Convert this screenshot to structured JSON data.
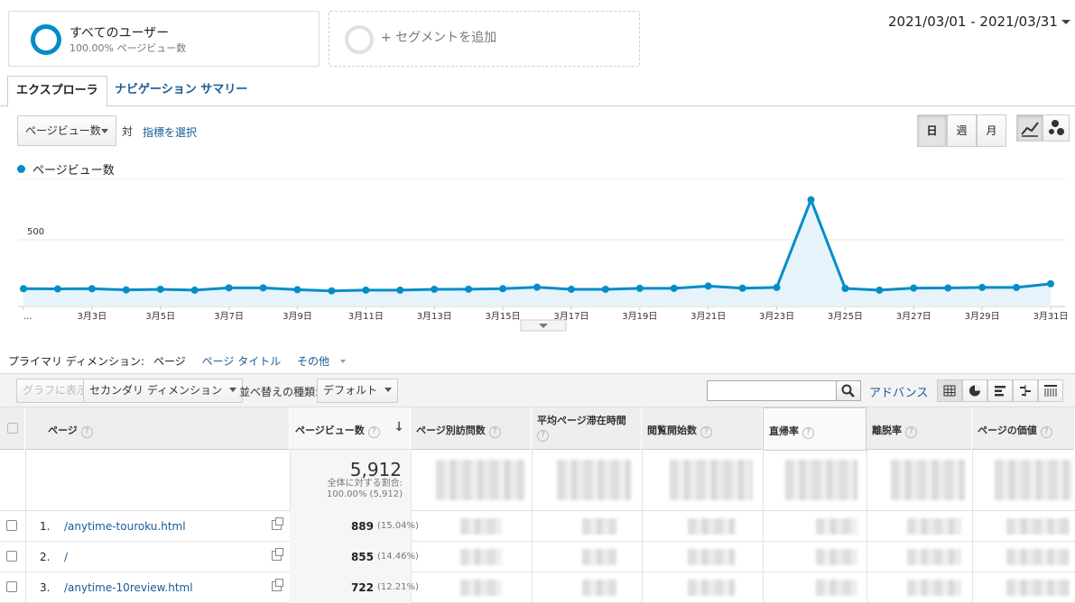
{
  "segments": {
    "all_users": {
      "title": "すべてのユーザー",
      "subtitle": "100.00% ページビュー数"
    },
    "add_segment": "+ セグメントを追加"
  },
  "date_range": "2021/03/01 - 2021/03/31",
  "tabs": [
    {
      "label": "エクスプローラ",
      "active": true
    },
    {
      "label": "ナビゲーション サマリー",
      "active": false
    }
  ],
  "chart_controls": {
    "metric": "ページビュー数",
    "vs": "対",
    "choose_metric": "指標を選択",
    "period_buttons": [
      "日",
      "週",
      "月"
    ],
    "active_period": "日"
  },
  "chart_data": {
    "type": "area",
    "series": [
      {
        "name": "ページビュー数",
        "color": "#058dc7",
        "values": [
          145,
          143,
          145,
          135,
          140,
          133,
          152,
          152,
          137,
          127,
          133,
          133,
          140,
          141,
          145,
          157,
          140,
          140,
          148,
          148,
          166,
          149,
          155,
          870,
          147,
          133,
          150,
          151,
          155,
          155,
          185
        ]
      }
    ],
    "x": [
      "3月1日",
      "3月2日",
      "3月3日",
      "3月4日",
      "3月5日",
      "3月6日",
      "3月7日",
      "3月8日",
      "3月9日",
      "3月10日",
      "3月11日",
      "3月12日",
      "3月13日",
      "3月14日",
      "3月15日",
      "3月16日",
      "3月17日",
      "3月18日",
      "3月19日",
      "3月20日",
      "3月21日",
      "3月22日",
      "3月23日",
      "3月24日",
      "3月25日",
      "3月26日",
      "3月27日",
      "3月28日",
      "3月29日",
      "3月30日",
      "3月31日"
    ],
    "x_tick_labels": [
      "...",
      "3月3日",
      "3月5日",
      "3月7日",
      "3月9日",
      "3月11日",
      "3月13日",
      "3月15日",
      "3月17日",
      "3月19日",
      "3月21日",
      "3月23日",
      "3月25日",
      "3月27日",
      "3月29日",
      "3月31日"
    ],
    "y_tick_labels": [
      "1,000",
      "500"
    ],
    "ylim": [
      0,
      1000
    ],
    "grid": true,
    "legend": "top-left"
  },
  "dimensions": {
    "label": "プライマリ ディメンション:",
    "current": "ページ",
    "alt": "ページ タイトル",
    "more": "その他"
  },
  "toolbar": {
    "plot_rows": "グラフに表示",
    "secondary_dimension": "セカンダリ ディメンション",
    "sort_type_label": "並べ替えの種類:",
    "sort_value": "デフォルト",
    "advanced": "アドバンス"
  },
  "table": {
    "headers": [
      "ページ",
      "ページビュー数",
      "ページ別訪問数",
      "平均ページ滞在時間",
      "閲覧開始数",
      "直帰率",
      "離脱率",
      "ページの価値"
    ],
    "total": {
      "value": "5,912",
      "pct_label": "全体に対する割合:",
      "pct_value": "100.00% (5,912)"
    },
    "rows": [
      {
        "index": "1.",
        "page": "/anytime-touroku.html",
        "views": "889",
        "pct": "(15.04%)"
      },
      {
        "index": "2.",
        "page": "/",
        "views": "855",
        "pct": "(14.46%)"
      },
      {
        "index": "3.",
        "page": "/anytime-10review.html",
        "views": "722",
        "pct": "(12.21%)"
      }
    ]
  }
}
